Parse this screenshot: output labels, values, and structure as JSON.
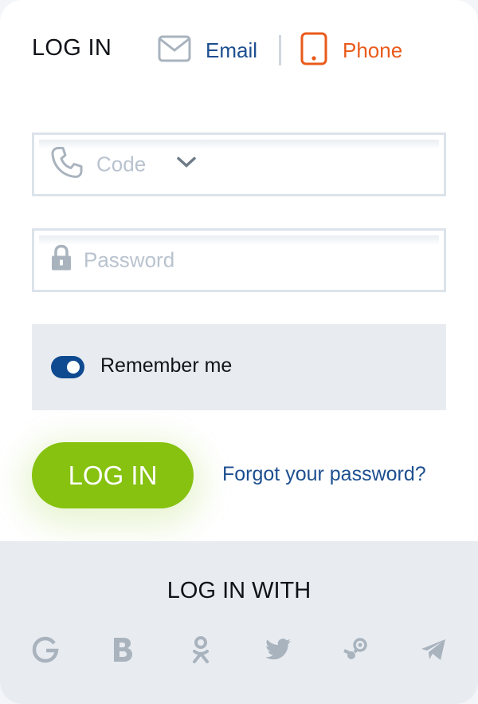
{
  "header": {
    "title": "LOG IN",
    "tabs": [
      {
        "label": "Email",
        "icon": "envelope-icon",
        "color": "#1d4f8f"
      },
      {
        "label": "Phone",
        "icon": "smartphone-icon",
        "color": "#ea5a1a",
        "active": true
      }
    ]
  },
  "form": {
    "phone_code_placeholder": "Code",
    "password_placeholder": "Password",
    "remember_label": "Remember me",
    "remember_checked": true,
    "submit_label": "LOG IN",
    "forgot_label": "Forgot your password?"
  },
  "social": {
    "title": "LOG IN WITH",
    "providers": [
      "google-icon",
      "b-icon",
      "odnoklassniki-icon",
      "twitter-icon",
      "steam-icon",
      "telegram-icon"
    ]
  },
  "colors": {
    "accent_green": "#86c20f",
    "brand_blue": "#1d4f8f",
    "phone_orange": "#ea5a1a",
    "icon_gray": "#a9b3be"
  }
}
